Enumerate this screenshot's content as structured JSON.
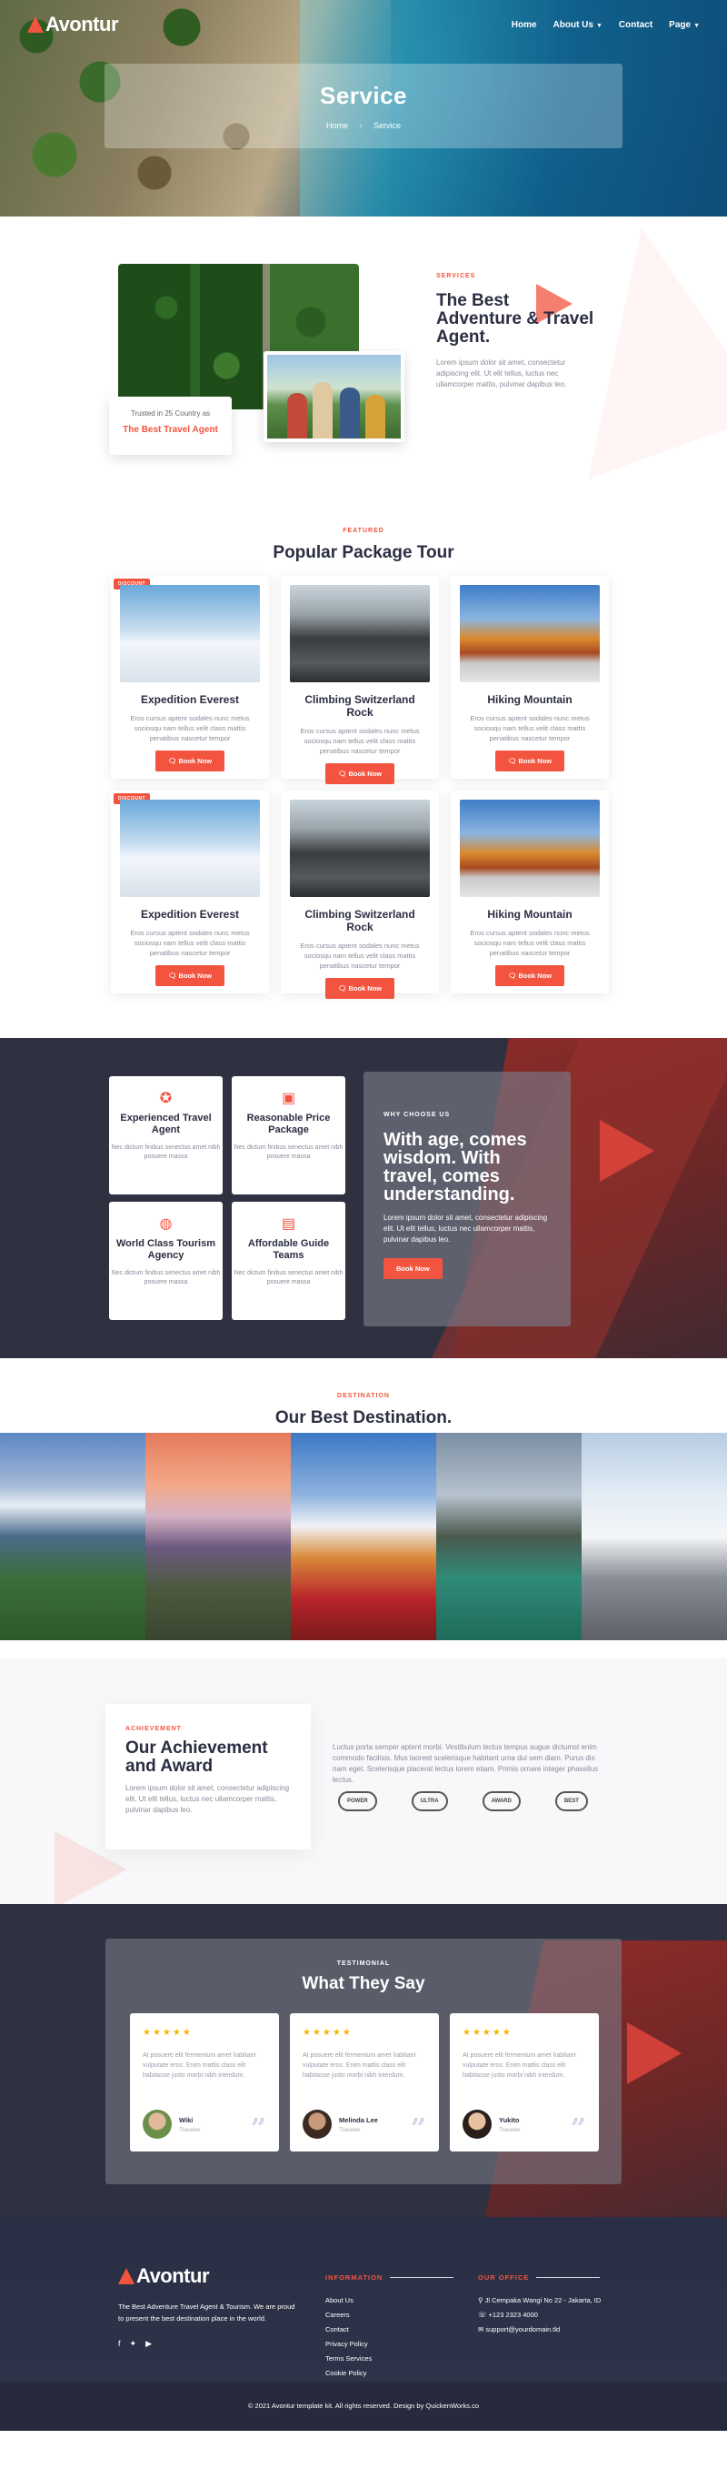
{
  "brand": {
    "name": "Avontur",
    "accent": "#f2543f"
  },
  "nav": {
    "home": "Home",
    "about": "About Us",
    "contact": "Contact",
    "page": "Page"
  },
  "hero": {
    "title": "Service",
    "breadcrumb_home": "Home",
    "breadcrumb_current": "Service"
  },
  "about": {
    "eyebrow": "SERVICES",
    "title": "The Best Adventure & Travel Agent.",
    "text": "Lorem ipsum dolor sit amet, consectetur adipiscing elit. Ut elit tellus, luctus nec ullamcorper mattis, pulvinar dapibus leo.",
    "trust_line": "Trusted in 25 Country as",
    "trust_title": "The Best Travel Agent"
  },
  "packages": {
    "eyebrow": "FEATURED",
    "title": "Popular Package Tour",
    "badge": "DISCOUNT",
    "button": "Book Now",
    "items": [
      {
        "name": "Expedition Everest",
        "desc": "Eros cursus aptent sodales nunc metus sociosqu nam tellus velit class mattis penatibus nascetur tempor"
      },
      {
        "name": "Climbing Switzerland Rock",
        "desc": "Eros cursus aptent sodales nunc metus sociosqu nam tellus velit class mattis penatibus nascetur tempor"
      },
      {
        "name": "Hiking Mountain",
        "desc": "Eros cursus aptent sodales nunc metus sociosqu nam tellus velit class mattis penatibus nascetur tempor"
      },
      {
        "name": "Expedition Everest",
        "desc": "Eros cursus aptent sodales nunc metus sociosqu nam tellus velit class mattis penatibus nascetur tempor"
      },
      {
        "name": "Climbing Switzerland Rock",
        "desc": "Eros cursus aptent sodales nunc metus sociosqu nam tellus velit class mattis penatibus nascetur tempor"
      },
      {
        "name": "Hiking Mountain",
        "desc": "Eros cursus aptent sodales nunc metus sociosqu nam tellus velit class mattis penatibus nascetur tempor"
      }
    ]
  },
  "why": {
    "eyebrow": "WHY CHOOSE US",
    "title": "With age, comes wisdom. With travel, comes understanding.",
    "text": "Lorem ipsum dolor sit amet, consectetur adipiscing elit. Ut elit tellus, luctus nec ullamcorper mattis, pulvinar dapibus leo.",
    "button": "Book Now",
    "features": [
      {
        "title": "Experienced Travel Agent",
        "text": "Nec dictum finibus senectus amet nibh posuere massa"
      },
      {
        "title": "Reasonable Price Package",
        "text": "Nec dictum finibus senectus amet nibh posuere massa"
      },
      {
        "title": "World Class Tourism Agency",
        "text": "Nec dictum finibus senectus amet nibh posuere massa"
      },
      {
        "title": "Affordable Guide Teams",
        "text": "Nec dictum finibus senectus amet nibh posuere massa"
      }
    ]
  },
  "destination": {
    "eyebrow": "DESTINATION",
    "title": "Our Best Destination."
  },
  "achievement": {
    "eyebrow": "ACHIEVEMENT",
    "title": "Our Achievement and Award",
    "text": "Lorem ipsum dolor sit amet, consectetur adipiscing elit. Ut elit tellus, luctus nec ullamcorper mattis, pulvinar dapibus leo.",
    "side_text": "Luctus porta semper aptent morbi. Vestibulum lectus tempus augue dictumst enim commodo facilisis. Mus laoreet scelerisque habitant urna dui sem diam. Purus dis nam eget. Scelerisque placerat lectus lorem etiam. Primis ornare integer phasellus lectus.",
    "awards": [
      "POWER",
      "ULTRA",
      "AWARD",
      "BEST"
    ]
  },
  "testimonial": {
    "eyebrow": "TESTIMONIAL",
    "title": "What They Say",
    "stars": "★★★★★",
    "items": [
      {
        "text": "At posuere elit fermentum amet habitant vulputate eros. Enim mattis class elit habitasse justo morbi nibh interdum.",
        "name": "Wiki",
        "role": "Traveler"
      },
      {
        "text": "At posuere elit fermentum amet habitant vulputate eros. Enim mattis class elit habitasse justo morbi nibh interdum.",
        "name": "Melinda Lee",
        "role": "Traveler"
      },
      {
        "text": "At posuere elit fermentum amet habitant vulputate eros. Enim mattis class elit habitasse justo morbi nibh interdum.",
        "name": "Yukito",
        "role": "Traveler"
      }
    ]
  },
  "footer": {
    "tagline": "The Best Adventure Travel Agent & Tourism. We are proud to present the best destination place in the world.",
    "info_title": "INFORMATION",
    "links": [
      "About Us",
      "Careers",
      "Contact",
      "Privacy Policy",
      "Terms Services",
      "Cookie Policy"
    ],
    "office_title": "OUR OFFICE",
    "address": "Jl Cempaka Wangi No 22 - Jakarta, ID",
    "phone": "+123 2323 4000",
    "email": "support@yourdomain.tld",
    "copyright": "© 2021 Avontur template kit. All rights reserved. Design by QuickenWorks.co"
  }
}
